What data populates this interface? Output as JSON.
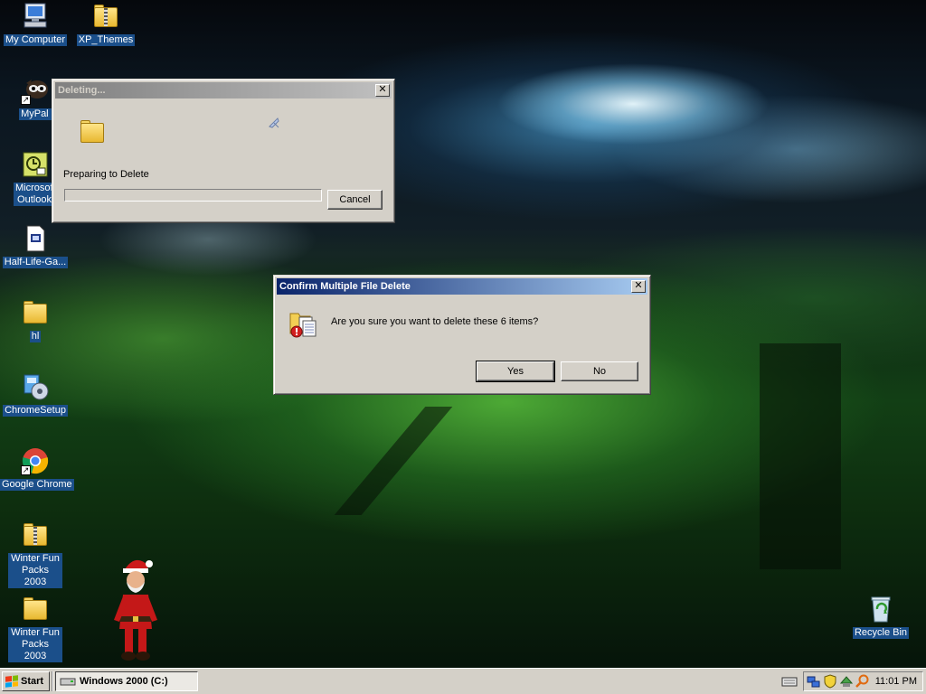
{
  "desktop": {
    "icons": [
      {
        "label": "My Computer",
        "icon": "my-computer-icon"
      },
      {
        "label": "XP_Themes",
        "icon": "zip-folder-icon"
      },
      {
        "label": "MyPal 68",
        "icon": "mypal-icon"
      },
      {
        "label": "Microsoft Outlook",
        "icon": "outlook-icon"
      },
      {
        "label": "Half-Life-Ga...",
        "icon": "document-icon"
      },
      {
        "label": "hl",
        "icon": "folder-icon"
      },
      {
        "label": "ChromeSetup",
        "icon": "installer-icon"
      },
      {
        "label": "Google Chrome",
        "icon": "chrome-icon"
      },
      {
        "label": "Winter Fun Packs 2003",
        "icon": "zip-folder-icon"
      },
      {
        "label": "Winter Fun Packs 2003",
        "icon": "folder-icon"
      },
      {
        "label": "Recycle Bin",
        "icon": "recycle-bin-icon"
      }
    ]
  },
  "deleting_dialog": {
    "title": "Deleting...",
    "status": "Preparing to Delete",
    "progress": 0,
    "cancel_label": "Cancel"
  },
  "confirm_dialog": {
    "title": "Confirm Multiple File Delete",
    "message": "Are you sure you want to delete these 6 items?",
    "yes_label": "Yes",
    "no_label": "No"
  },
  "taskbar": {
    "start_label": "Start",
    "task_label": "Windows 2000 (C:)",
    "clock": "11:01 PM",
    "tray_icons": [
      "keyboard-icon",
      "network-icon",
      "security-shield-icon",
      "update-icon",
      "search-icon"
    ]
  },
  "colors": {
    "active_title_start": "#0a246a",
    "active_title_end": "#a6caf0",
    "window_face": "#d4d0c8",
    "icon_label_bg": "#1b4f8a"
  }
}
